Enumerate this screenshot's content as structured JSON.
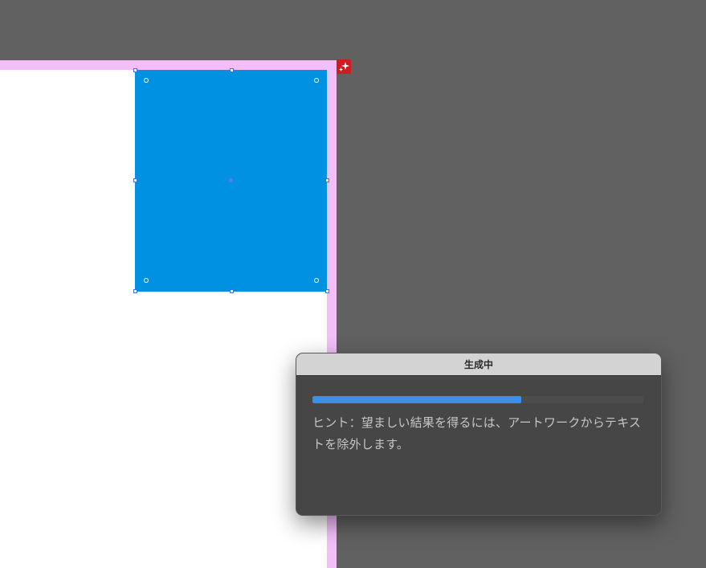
{
  "dialog": {
    "title": "生成中",
    "progress_fraction": 0.63,
    "hint": "ヒント：望ましい結果を得るには、アートワークからテキストを除外します。"
  },
  "colors": {
    "canvas_background": "#616161",
    "artboard_border": "#f2bff8",
    "artboard": "#ffffff",
    "selected_shape_fill": "#0091e2",
    "ai_badge": "#d01c1c",
    "progress_fill": "#3d8ee6",
    "dialog_background": "#464646",
    "dialog_titlebar": "#d3d3d3"
  },
  "icons": {
    "ai_badge": "sparkle-icon"
  }
}
